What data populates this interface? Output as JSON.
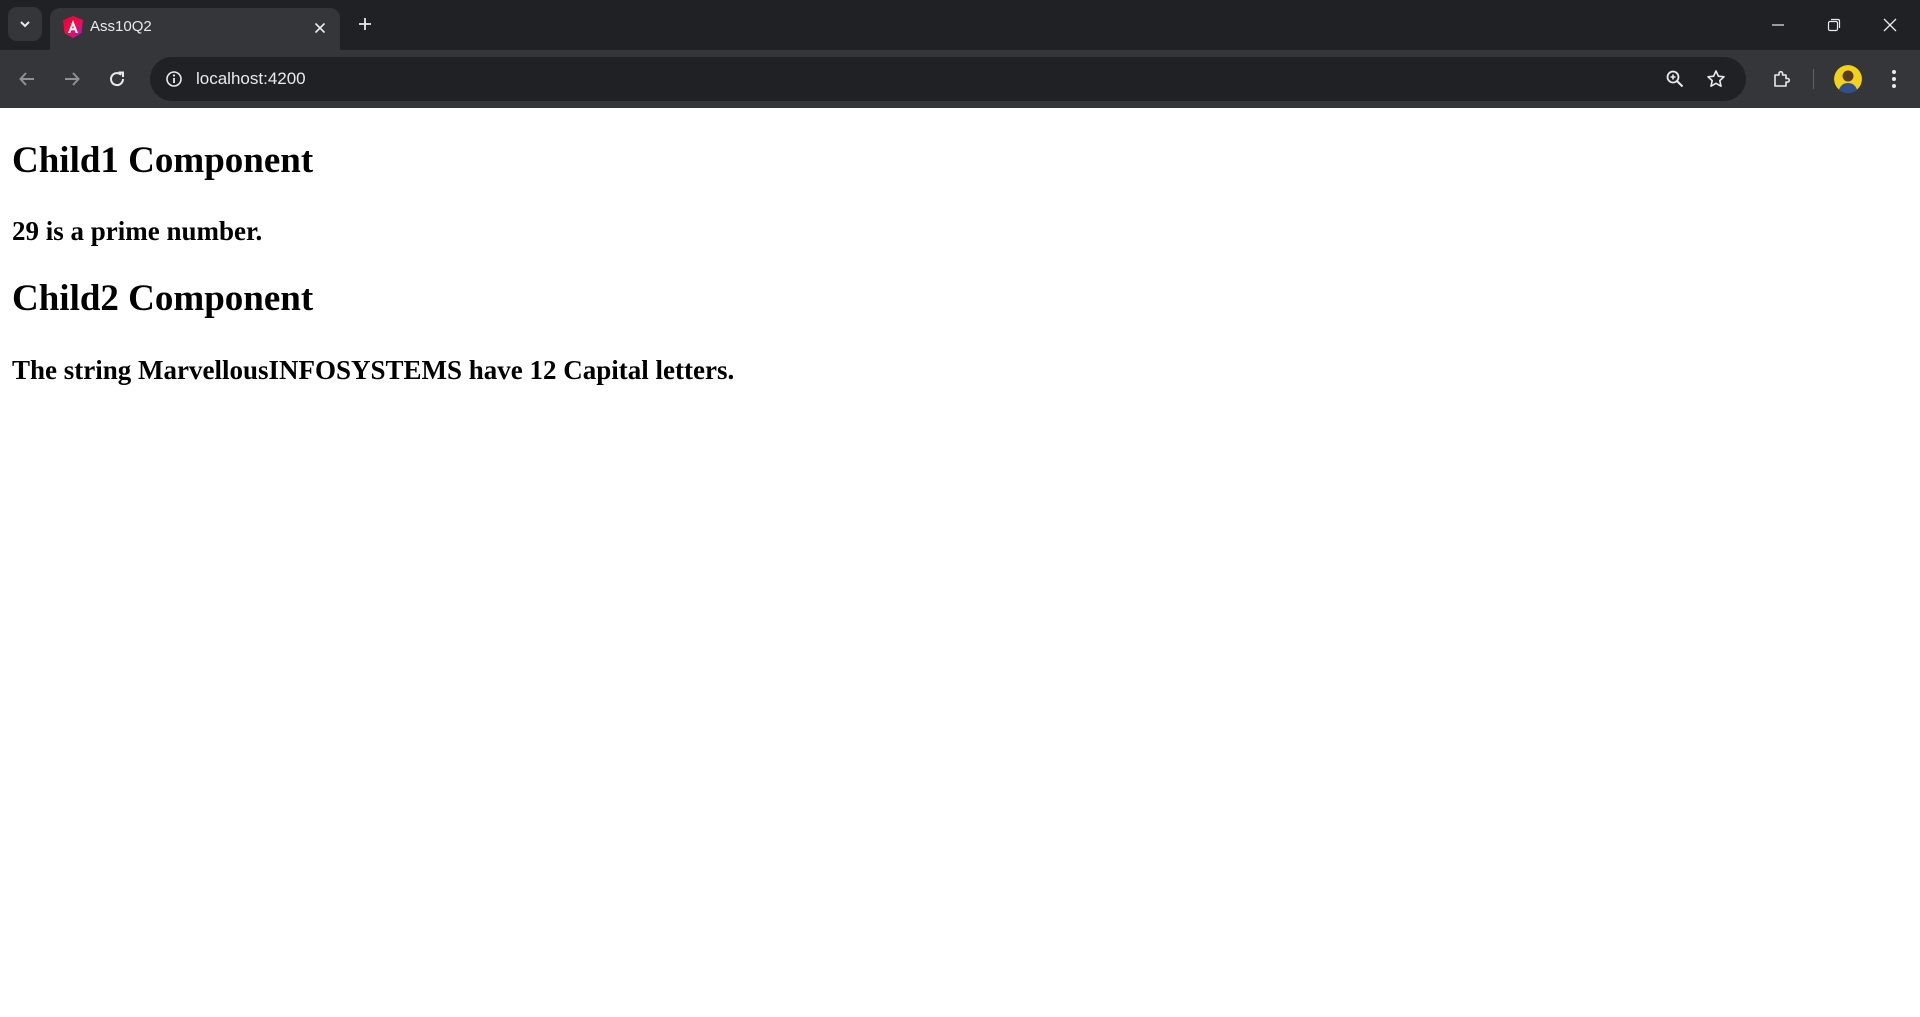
{
  "browser": {
    "tab": {
      "title": "Ass10Q2",
      "favicon": "angular-icon"
    },
    "address_bar": {
      "url": "localhost:4200"
    },
    "icons": {
      "tab_search": "chevron-down-icon",
      "tab_close": "close-icon",
      "new_tab": "plus-icon",
      "minimize": "minimize-icon",
      "restore": "restore-icon",
      "close_window": "close-icon",
      "back": "arrow-left-icon",
      "forward": "arrow-right-icon",
      "reload": "reload-icon",
      "site_info": "info-icon",
      "zoom": "zoom-in-icon",
      "bookmark": "star-icon",
      "extensions": "puzzle-icon",
      "menu": "kebab-menu-icon"
    },
    "colors": {
      "tabstrip": "#202124",
      "toolbar": "#35363a",
      "omnibox": "#202124",
      "text": "#e8eaed"
    }
  },
  "page": {
    "child1": {
      "heading": "Child1 Component",
      "message": "29 is a prime number."
    },
    "child2": {
      "heading": "Child2 Component",
      "message": "The string MarvellousINFOSYSTEMS have 12 Capital letters."
    }
  }
}
